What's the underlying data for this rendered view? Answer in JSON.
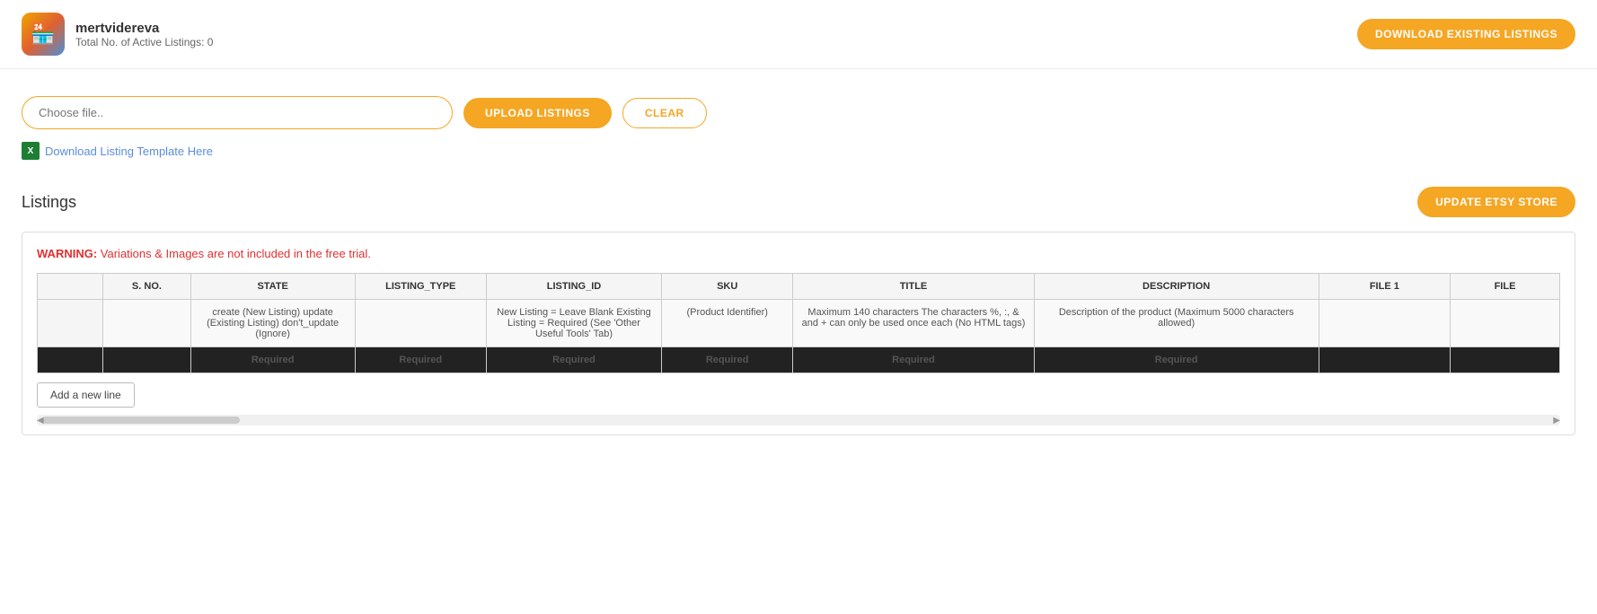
{
  "header": {
    "store_name": "mertvidereva",
    "store_subtitle": "Total No. of Active Listings: 0",
    "download_existing_label": "DOWNLOAD EXISTING LISTINGS",
    "store_icon_emoji": "🏪"
  },
  "upload": {
    "file_input_placeholder": "Choose file..",
    "upload_button_label": "UPLOAD LISTINGS",
    "clear_button_label": "CLEAR",
    "template_link_text": "Download Listing Template Here"
  },
  "listings": {
    "section_title": "Listings",
    "update_button_label": "UPDATE ETSY STORE",
    "warning_label": "WARNING:",
    "warning_text": "  Variations & Images are not included in the free trial.",
    "table": {
      "columns": [
        {
          "key": "rownum",
          "label": ""
        },
        {
          "key": "sno",
          "label": "S. NO."
        },
        {
          "key": "state",
          "label": "STATE"
        },
        {
          "key": "listing_type",
          "label": "LISTING_TYPE"
        },
        {
          "key": "listing_id",
          "label": "LISTING_ID"
        },
        {
          "key": "sku",
          "label": "SKU"
        },
        {
          "key": "title",
          "label": "TITLE"
        },
        {
          "key": "description",
          "label": "DESCRIPTION"
        },
        {
          "key": "file1",
          "label": "FILE 1"
        },
        {
          "key": "file2",
          "label": "FILE"
        }
      ],
      "hint_row": {
        "rownum": "",
        "sno": "",
        "state": "create (New Listing) update (Existing Listing) don't_update (Ignore)",
        "listing_type": "",
        "listing_id": "New Listing = Leave Blank Existing Listing = Required (See 'Other Useful Tools' Tab)",
        "sku": "(Product Identifier)",
        "title": "Maximum 140 characters The characters %, :, & and + can only be used once each (No HTML tags)",
        "description": "Description of the product (Maximum 5000 characters allowed)",
        "file1": "",
        "file2": ""
      },
      "required_row": {
        "rownum": "",
        "sno": "",
        "state": "Required",
        "listing_type": "Required",
        "listing_id": "Required",
        "sku": "Required",
        "title": "Required",
        "description": "Required",
        "file1": "",
        "file2": ""
      },
      "add_line_label": "Add a new line"
    }
  }
}
